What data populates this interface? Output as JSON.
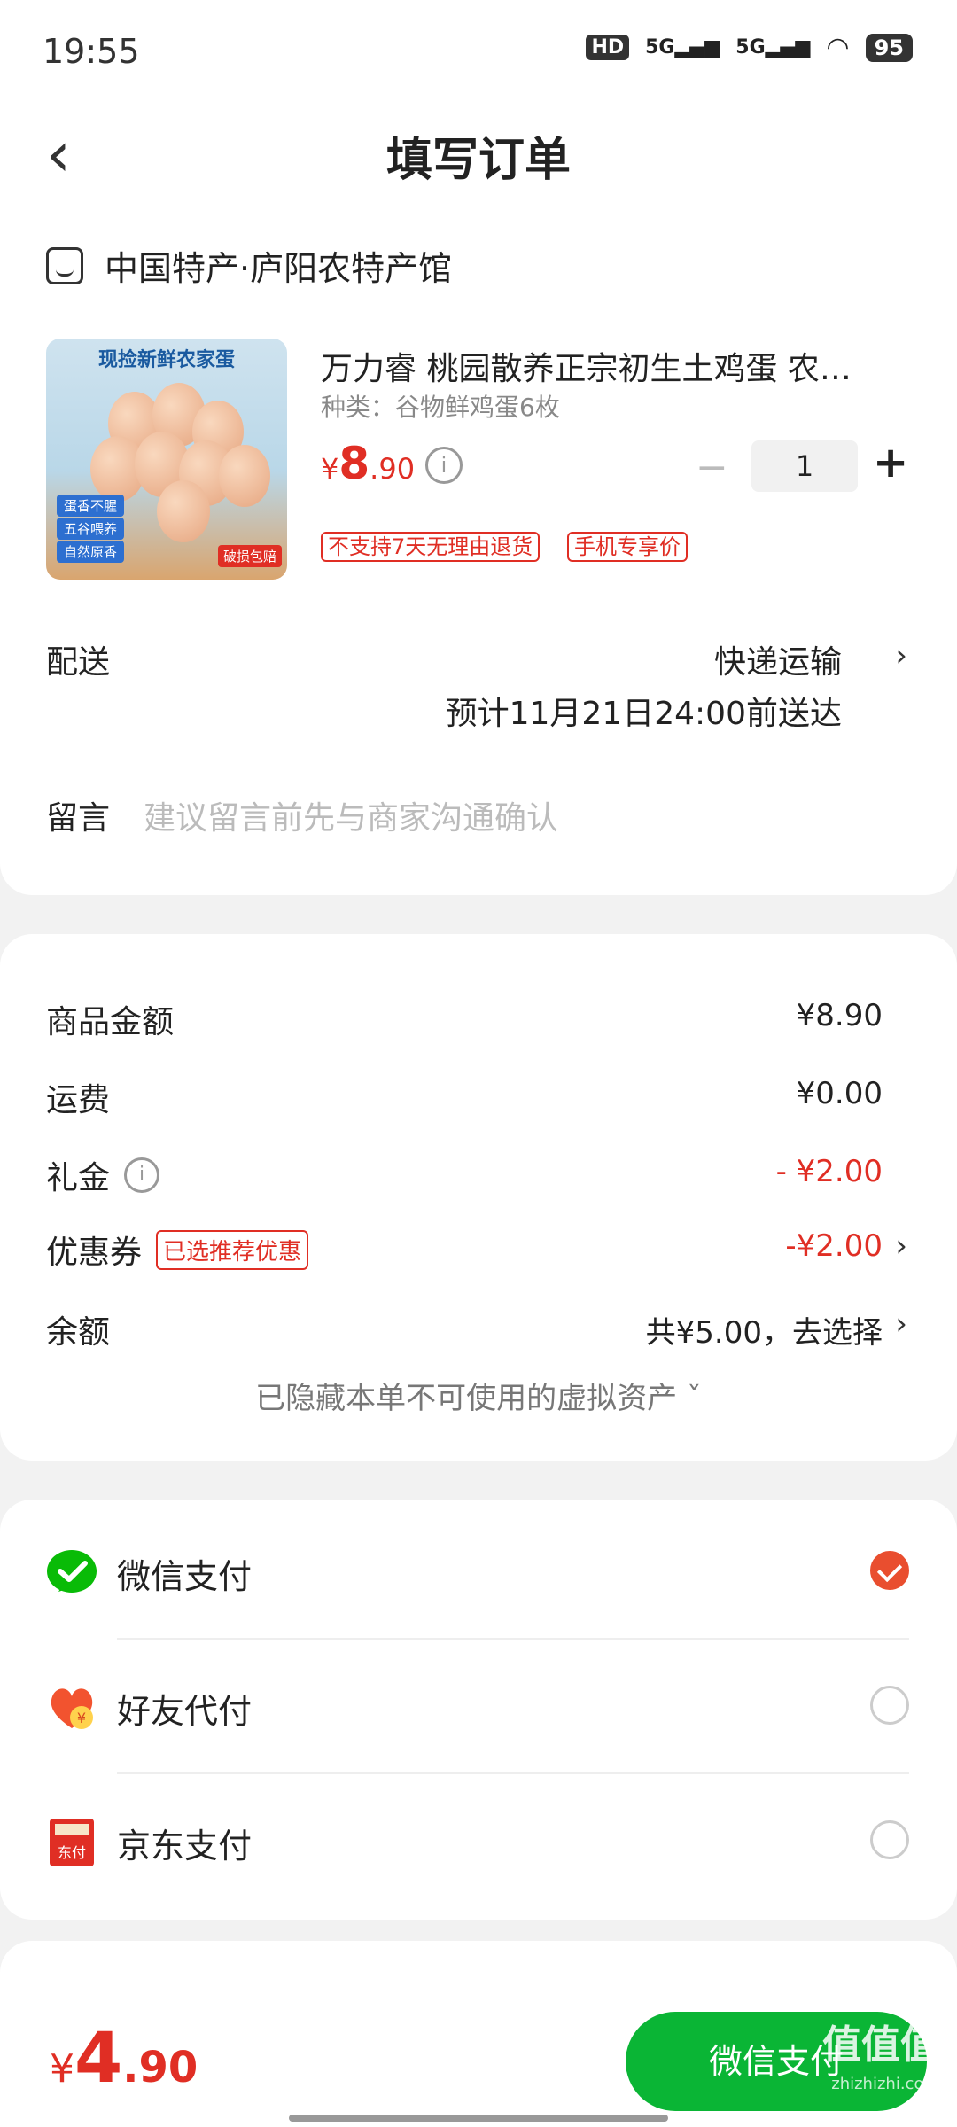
{
  "status_bar": {
    "time": "19:55",
    "hd": "HD",
    "sig1": "5G",
    "sig2": "5G",
    "battery": "95"
  },
  "nav": {
    "back_icon": "chevron-left-icon",
    "title": "填写订单"
  },
  "store": {
    "icon": "store-icon",
    "name": "中国特产·庐阳农特产馆"
  },
  "product": {
    "image_caption": "现捡新鲜农家蛋",
    "image_tags": [
      "蛋香不腥",
      "五谷喂养",
      "自然原香"
    ],
    "image_badge": "破损包赔",
    "title": "万力睿 桃园散养正宗初生土鸡蛋 农…",
    "spec": "种类：谷物鲜鸡蛋6枚",
    "price_currency": "¥",
    "price_int": "8",
    "price_dec": ".90",
    "quantity": "1",
    "minus": "−",
    "plus": "+",
    "tags": [
      "不支持7天无理由退货",
      "手机专享价"
    ]
  },
  "delivery": {
    "label": "配送",
    "method": "快递运输",
    "eta": "预计11月21日24:00前送达"
  },
  "message": {
    "label": "留言",
    "placeholder": "建议留言前先与商家沟通确认"
  },
  "amounts": {
    "goods_label": "商品金额",
    "goods_value": "¥8.90",
    "shipping_label": "运费",
    "shipping_value": "¥0.00",
    "gift_label": "礼金",
    "gift_value": "- ¥2.00",
    "coupon_label": "优惠券",
    "coupon_tag": "已选推荐优惠",
    "coupon_value": "-¥2.00",
    "balance_label": "余额",
    "balance_value": "共¥5.00，去选择",
    "hidden_note": "已隐藏本单不可使用的虚拟资产 ˇ"
  },
  "payment": {
    "methods": [
      {
        "icon": "wechat-pay-icon",
        "label": "微信支付",
        "selected": true
      },
      {
        "icon": "friend-pay-icon",
        "label": "好友代付",
        "selected": false
      },
      {
        "icon": "jd-pay-icon",
        "label": "京东支付",
        "selected": false
      }
    ]
  },
  "bottom": {
    "total_currency": "¥",
    "total_int": "4",
    "total_dec": ".90",
    "pay_button": "微信支付",
    "watermark": "值值值",
    "watermark_sub": "zhizhizhi.com"
  },
  "colors": {
    "accent_red": "#e02e24",
    "wechat_green": "#0ab535",
    "radio_on": "#e94e2f"
  }
}
